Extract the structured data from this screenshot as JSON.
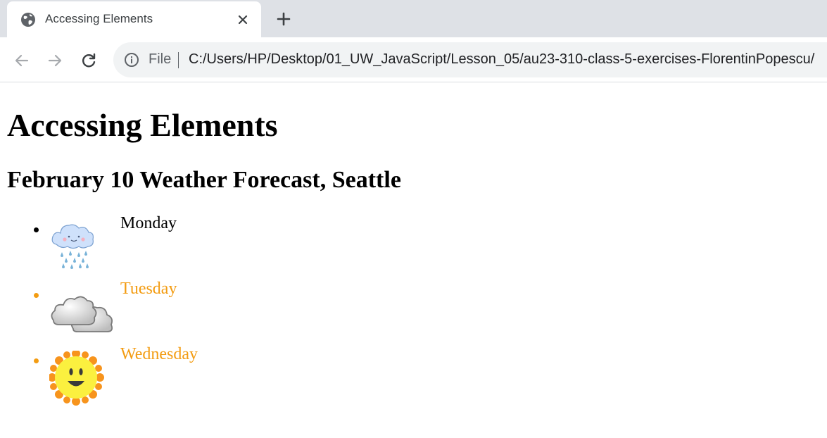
{
  "browser": {
    "tab_title": "Accessing Elements",
    "address_scheme_label": "File",
    "url": "C:/Users/HP/Desktop/01_UW_JavaScript/Lesson_05/au23-310-class-5-exercises-FlorentinPopescu/"
  },
  "page": {
    "heading": "Accessing Elements",
    "subheading": "February 10 Weather Forecast, Seattle",
    "days": [
      {
        "label": "Monday",
        "icon": "rain-cloud-icon",
        "color": "#000000"
      },
      {
        "label": "Tuesday",
        "icon": "cloudy-icon",
        "color": "#f39c12"
      },
      {
        "label": "Wednesday",
        "icon": "sun-icon",
        "color": "#f39c12"
      }
    ]
  },
  "colors": {
    "tabstrip_bg": "#dee1e6",
    "omnibox_bg": "#f1f3f4",
    "highlight": "#f39c12"
  }
}
